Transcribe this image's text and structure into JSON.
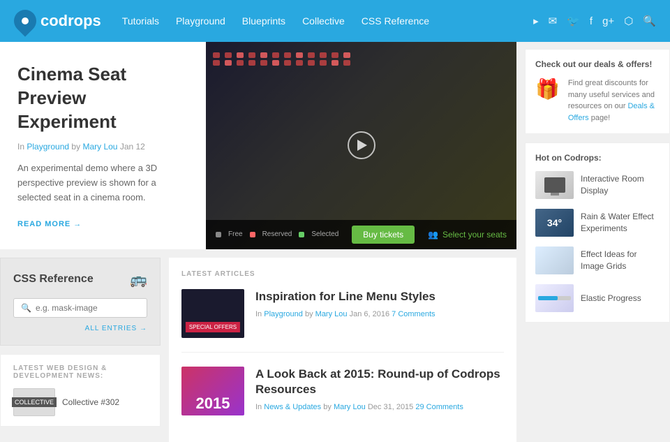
{
  "header": {
    "logo_text": "codrops",
    "nav": {
      "items": [
        {
          "label": "Tutorials",
          "href": "#"
        },
        {
          "label": "Playground",
          "href": "#"
        },
        {
          "label": "Blueprints",
          "href": "#"
        },
        {
          "label": "Collective",
          "href": "#"
        },
        {
          "label": "CSS Reference",
          "href": "#"
        }
      ]
    },
    "icons": [
      "rss-icon",
      "email-icon",
      "twitter-icon",
      "facebook-icon",
      "gplus-icon",
      "github-icon",
      "search-icon"
    ]
  },
  "featured": {
    "title": "Cinema Seat Preview Experiment",
    "meta_in": "In",
    "meta_category": "Playground",
    "meta_by": "by",
    "meta_author": "Mary Lou",
    "meta_date": "Jan 12",
    "description": "An experimental demo where a 3D perspective preview is shown for a selected seat in a cinema room.",
    "read_more": "READ MORE →",
    "cinema": {
      "legend_free": "Free",
      "legend_reserved": "Reserved",
      "legend_selected": "Selected",
      "buy_btn": "Buy tickets",
      "select_seats": "Select your seats"
    }
  },
  "css_reference": {
    "title": "CSS Reference",
    "placeholder": "e.g. mask-image",
    "all_entries": "ALL ENTRIES →"
  },
  "latest_news": {
    "label": "LATEST WEB DESIGN & DEVELOPMENT NEWS:",
    "item": "Collective #302"
  },
  "latest_articles": {
    "label": "LATEST ARTICLES",
    "items": [
      {
        "title": "Inspiration for Line Menu Styles",
        "meta_in": "In",
        "meta_category": "Playground",
        "meta_by": "by",
        "meta_author": "Mary Lou",
        "meta_date": "Jan 6, 2016",
        "comments": "7 Comments",
        "badge": "Special Offers"
      },
      {
        "title": "A Look Back at 2015: Round-up of Codrops Resources",
        "meta_in": "In",
        "meta_category": "News & Updates",
        "meta_by": "by",
        "meta_author": "Mary Lou",
        "meta_date": "Dec 31, 2015",
        "comments": "29 Comments",
        "year": "2015"
      }
    ]
  },
  "right_sidebar": {
    "deals": {
      "title": "Check out our deals & offers!",
      "text": "Find great discounts for many useful services and resources on our",
      "link_text": "Deals & Offers",
      "text_suffix": "page!"
    },
    "hot": {
      "title": "Hot on Codrops:",
      "items": [
        {
          "title": "Interactive Room Display"
        },
        {
          "title": "Rain & Water Effect Experiments"
        },
        {
          "title": "Effect Ideas for Image Grids"
        },
        {
          "title": "Elastic Progress"
        }
      ]
    }
  }
}
